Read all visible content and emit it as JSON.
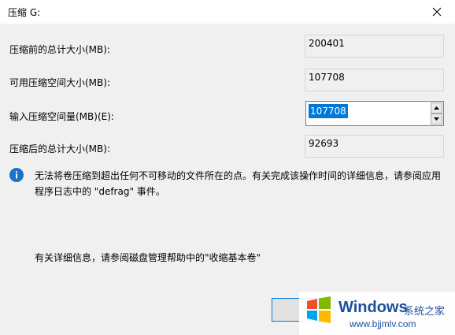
{
  "window": {
    "title": "压缩 G:"
  },
  "fields": [
    {
      "label": "压缩前的总计大小(MB):",
      "value": "200401"
    },
    {
      "label": "可用压缩空间大小(MB):",
      "value": "107708"
    },
    {
      "label": "输入压缩空间量(MB)(E):",
      "value": "107708"
    },
    {
      "label": "压缩后的总计大小(MB):",
      "value": "92693"
    }
  ],
  "info": {
    "message": "无法将卷压缩到超出任何不可移动的文件所在的点。有关完成该操作时间的详细信息，请参阅应用程序日志中的 \"defrag\" 事件。",
    "help": "有关详细信息，请参阅磁盘管理帮助中的\"收缩基本卷\""
  },
  "watermark": {
    "title": "Windows",
    "subtitle": "系统之家",
    "url": "www.bjjmlv.com"
  },
  "colors": {
    "accent": "#0078d7",
    "info_icon": "#1a73c9",
    "watermark_text": "#1c4f9c"
  },
  "icons": [
    "close-icon",
    "spin-up-icon",
    "spin-down-icon",
    "info-icon",
    "windows-logo-icon"
  ]
}
